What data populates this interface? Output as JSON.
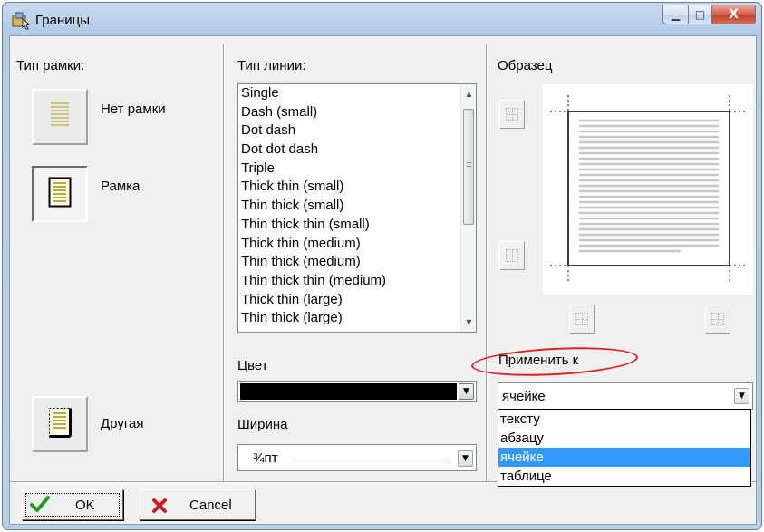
{
  "window": {
    "title": "Границы",
    "controls": {
      "minimize": "▁",
      "maximize": "□",
      "close": "X"
    }
  },
  "frame_type": {
    "label": "Тип рамки:",
    "options": [
      {
        "label": "Нет рамки"
      },
      {
        "label": "Рамка"
      },
      {
        "label": "Другая"
      }
    ]
  },
  "line_type": {
    "label": "Тип линии:",
    "items": [
      "Single",
      "Dash (small)",
      "Dot dash",
      "Dot dot dash",
      "Triple",
      "Thick thin (small)",
      "Thin thick (small)",
      "Thin thick thin (small)",
      "Thick thin (medium)",
      "Thin thick (medium)",
      "Thin thick thin (medium)",
      "Thick thin (large)",
      "Thin thick (large)"
    ]
  },
  "color": {
    "label": "Цвет",
    "value": "#000000"
  },
  "width": {
    "label": "Ширина",
    "value": "¾пт"
  },
  "preview": {
    "label": "Образец"
  },
  "apply_to": {
    "label": "Применить к",
    "selected": "ячейке",
    "options": [
      "тексту",
      "абзацу",
      "ячейке",
      "таблице"
    ],
    "highlighted_index": 2
  },
  "buttons": {
    "ok": "OK",
    "cancel": "Cancel"
  }
}
